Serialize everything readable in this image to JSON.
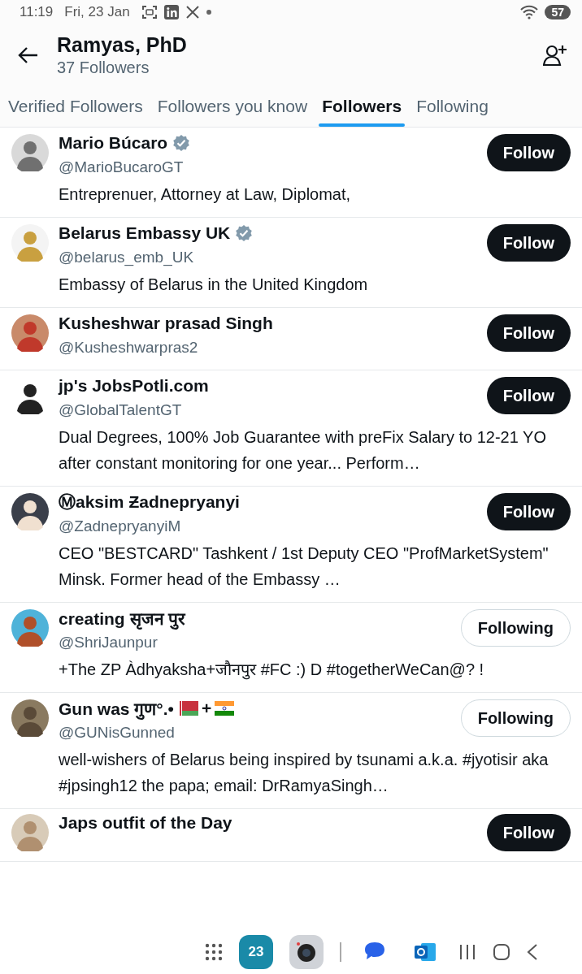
{
  "status_bar": {
    "time": "11:19",
    "date": "Fri, 23 Jan",
    "battery": "57"
  },
  "header": {
    "title": "Ramyas, PhD",
    "subtitle": "37 Followers"
  },
  "tabs": [
    {
      "label": "Verified Followers",
      "selected": false
    },
    {
      "label": "Followers you know",
      "selected": false
    },
    {
      "label": "Followers",
      "selected": true
    },
    {
      "label": "Following",
      "selected": false
    }
  ],
  "users": [
    {
      "name": "Mario Búcaro",
      "verified": true,
      "handle": "@MarioBucaroGT",
      "bio": "Entreprenuer, Attorney at Law, Diplomat,",
      "button": "Follow",
      "following": false
    },
    {
      "name": "Belarus Embassy UK",
      "verified": true,
      "handle": "@belarus_emb_UK",
      "bio": "Embassy of Belarus in the United Kingdom",
      "button": "Follow",
      "following": false
    },
    {
      "name": "Kusheshwar prasad Singh",
      "verified": false,
      "handle": "@Kusheshwarpras2",
      "button": "Follow",
      "following": false
    },
    {
      "name": "jp's JobsPotli.com",
      "verified": false,
      "handle": "@GlobalTalentGT",
      "bio": "Dual Degrees, 100% Job Guarantee with preFix Salary to 12-21 YO after constant monitoring for one year... Perform…",
      "button": "Follow",
      "following": false
    },
    {
      "name": "Ⓜaksim Ƶadnepryanyi",
      "verified": false,
      "handle": "@ZadnepryanyiM",
      "bio": "CEO \"BESTCARD\" Tashkent / 1st Deputy CEO \"ProfMarketSystem\" Minsk. Former head of the Embassy …",
      "button": "Follow",
      "following": false
    },
    {
      "name": "creating सृजन पुर",
      "verified": false,
      "handle": "@ShriJaunpur",
      "bio": "+The ZP Àdhyaksha+जौनपुर #FC :) D #togetherWeCan@? !",
      "button": "Following",
      "following": true
    },
    {
      "name": "Gun was गुण°.•",
      "flags": true,
      "flag_joiner": "+",
      "verified": false,
      "handle": "@GUNisGunned",
      "bio": "well-wishers of Belarus being inspired by tsunami a.k.a. #jyotisir aka #jpsingh12 the papa; email: DrRamyaSingh…",
      "button": "Following",
      "following": true
    },
    {
      "name": "Japs outfit of the Day",
      "verified": false,
      "button": "Follow",
      "following": false
    }
  ],
  "nav_bar": {
    "calendar_day": "23"
  }
}
